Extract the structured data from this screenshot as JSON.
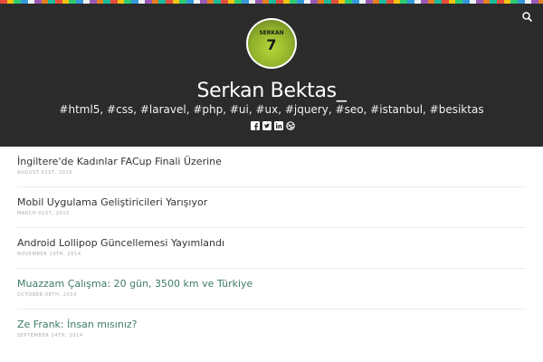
{
  "header": {
    "title": "Serkan Bektas_",
    "tagline": "#html5, #css, #laravel, #php, #ui, #ux, #jquery, #seo, #istanbul, #besiktas",
    "avatar": {
      "jersey_name": "SERKAN",
      "jersey_number": "7"
    },
    "search_icon": "search-icon",
    "social": [
      "facebook-icon",
      "twitter-icon",
      "linkedin-icon",
      "dribbble-icon"
    ]
  },
  "posts": [
    {
      "title": "İngiltere'de Kadınlar FACup Finali Üzerine",
      "date": "AUGUST 01ST, 2015",
      "visited": false
    },
    {
      "title": "Mobil Uygulama Geliştiricileri Yarışıyor",
      "date": "MARCH 01ST, 2015",
      "visited": false
    },
    {
      "title": "Android Lollipop Güncellemesi Yayımlandı",
      "date": "NOVEMBER 19TH, 2014",
      "visited": false
    },
    {
      "title": "Muazzam Çalışma: 20 gün, 3500 km ve Türkiye",
      "date": "OCTOBER 08TH, 2014",
      "visited": true
    },
    {
      "title": "Ze Frank: İnsan mısınız?",
      "date": "SEPTEMBER 24TH, 2014",
      "visited": true
    }
  ],
  "colors": {
    "header_bg": "#2b2b2b",
    "link": "#333333",
    "visited_link": "#3d7a6b",
    "date": "#aaaaaa"
  }
}
